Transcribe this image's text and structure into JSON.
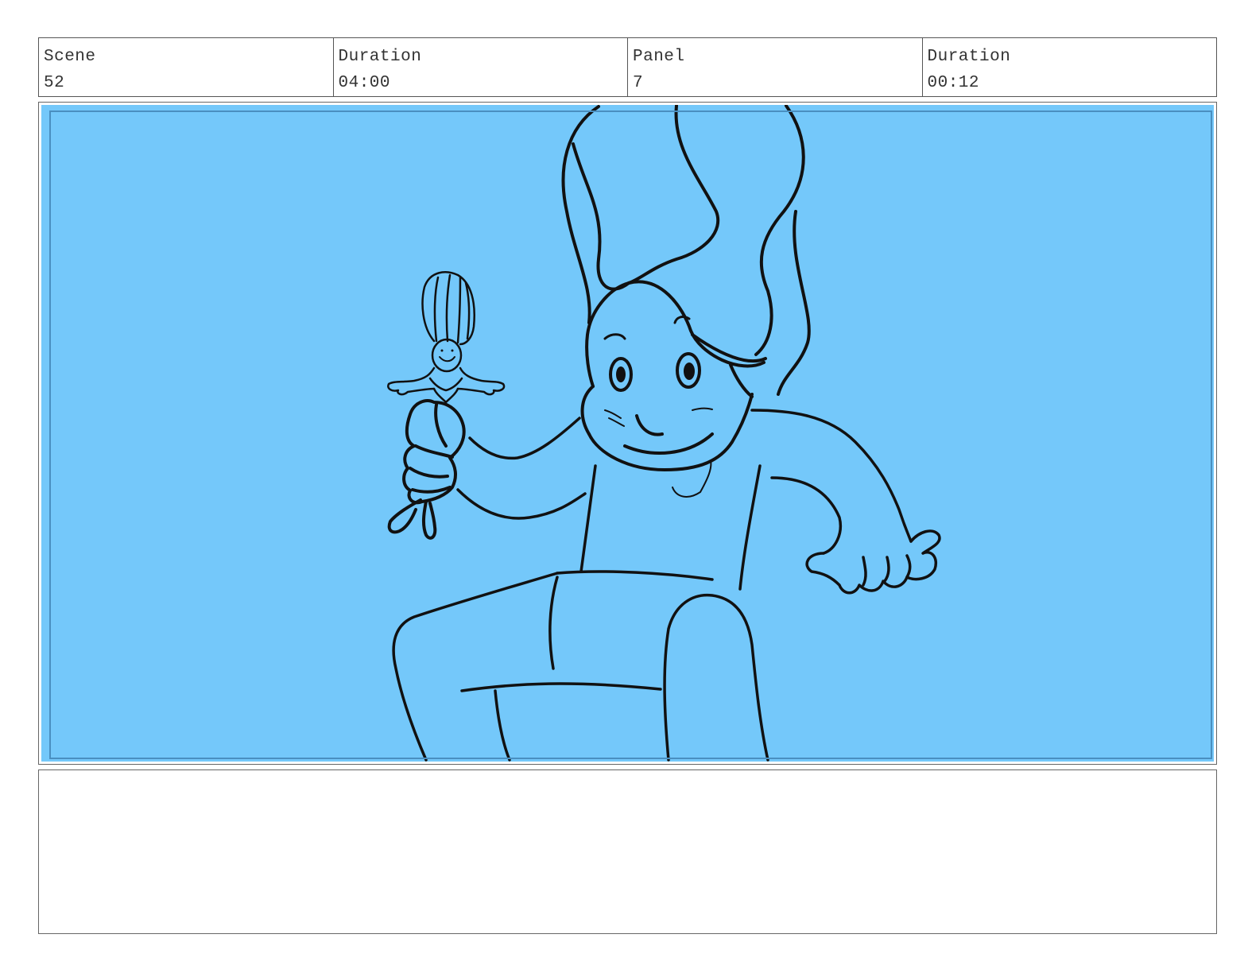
{
  "header": {
    "cells": [
      {
        "label": "Scene",
        "value": "52"
      },
      {
        "label": "Duration",
        "value": "04:00"
      },
      {
        "label": "Panel",
        "value": "7"
      },
      {
        "label": "Duration",
        "value": "00:12"
      }
    ]
  },
  "panel": {
    "background_color": "#74c8fa",
    "frame_color": "#4a8fc0",
    "line_color": "#111111"
  },
  "notes": {
    "text": ""
  }
}
